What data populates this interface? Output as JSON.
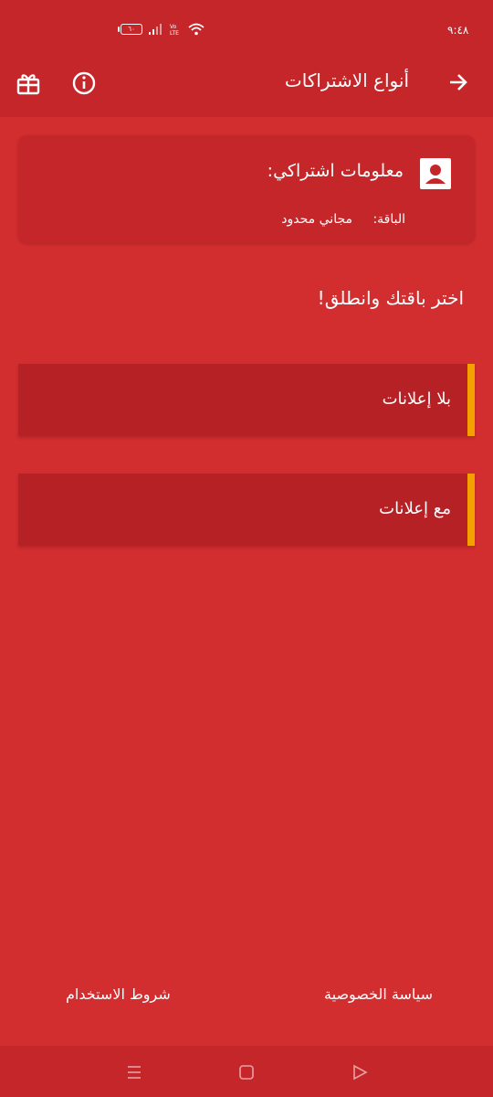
{
  "status_bar": {
    "time": "٩:٤٨",
    "battery": "٦٠"
  },
  "header": {
    "title": "أنواع الاشتراكات",
    "back_icon": "arrow-right-icon",
    "info_icon": "info-icon",
    "gift_icon": "gift-icon"
  },
  "subscription_card": {
    "title": "معلومات اشتراكي:",
    "plan_label": "الباقة:",
    "plan_value": "مجاني محدود",
    "icon": "user-avatar-icon"
  },
  "prompt": "اختر باقتك وانطلق!",
  "options": [
    {
      "label": "بلا إعلانات"
    },
    {
      "label": "مع إعلانات"
    }
  ],
  "footer": {
    "privacy": "سياسة الخصوصية",
    "terms": "شروط الاستخدام"
  },
  "colors": {
    "background": "#d22d2f",
    "bar": "#c4262a",
    "option": "#b52124",
    "accent": "#f6a000"
  }
}
